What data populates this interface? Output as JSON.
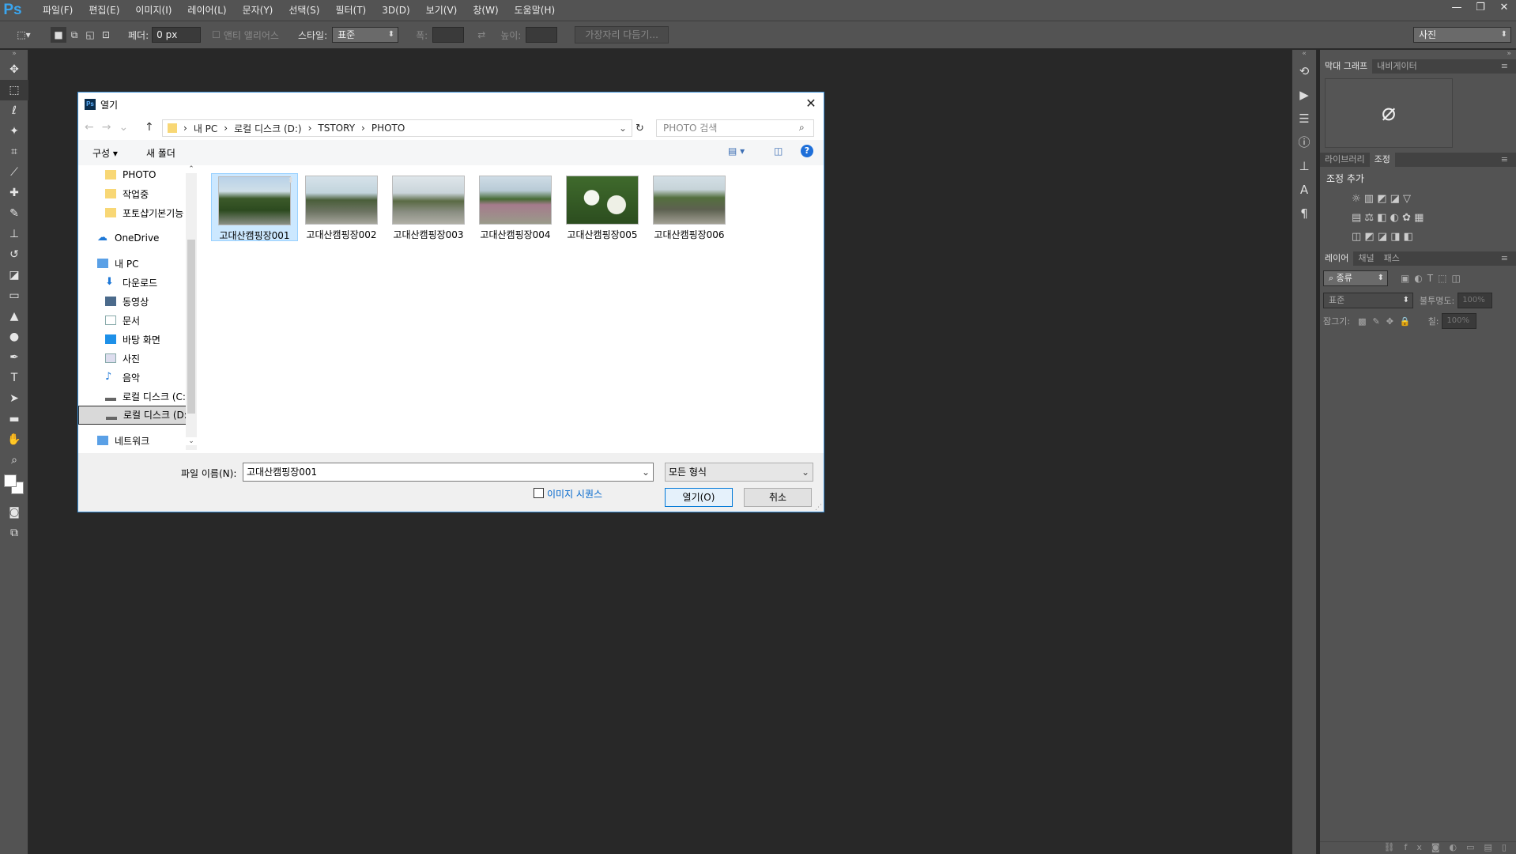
{
  "app": {
    "logo": "Ps"
  },
  "menu": [
    "파일(F)",
    "편집(E)",
    "이미지(I)",
    "레이어(L)",
    "문자(Y)",
    "선택(S)",
    "필터(T)",
    "3D(D)",
    "보기(V)",
    "창(W)",
    "도움말(H)"
  ],
  "window_controls": [
    "—",
    "❐",
    "✕"
  ],
  "options": {
    "feather_label": "페더:",
    "feather_value": "0 px",
    "antialias_label": "앤티 앨리어스",
    "style_label": "스타일:",
    "style_value": "표준",
    "width_label": "폭:",
    "height_label": "높이:",
    "refine_button": "가장자리 다듬기...",
    "workspace": "사진"
  },
  "right_panels": {
    "top_tabs": [
      "막대 그래프",
      "내비게이터"
    ],
    "mid_tabs": [
      "라이브러리",
      "조정"
    ],
    "adjust_title": "조정 추가",
    "layer_tabs": [
      "레이어",
      "채널",
      "패스"
    ],
    "kind_label": "⌕ 종류",
    "blend_mode": "표준",
    "opacity_label": "불투명도:",
    "opacity_value": "100%",
    "lock_label": "잠그기:",
    "fill_label": "칠:",
    "fill_value": "100%"
  },
  "dialog": {
    "title": "열기",
    "breadcrumb": [
      "내 PC",
      "로컬 디스크 (D:)",
      "TSTORY",
      "PHOTO"
    ],
    "search_placeholder": "PHOTO 검색",
    "organize": "구성 ▾",
    "new_folder": "새 폴더",
    "nav_items": [
      {
        "label": "PHOTO",
        "icon": "folder-icon"
      },
      {
        "label": "작업중",
        "icon": "folder-icon"
      },
      {
        "label": "포토샵기본기능",
        "icon": "folder-icon"
      },
      {
        "label": "OneDrive",
        "icon": "cloud-icon"
      },
      {
        "label": "내 PC",
        "icon": "computer-icon"
      },
      {
        "label": "다운로드",
        "icon": "download-icon"
      },
      {
        "label": "동영상",
        "icon": "video-icon"
      },
      {
        "label": "문서",
        "icon": "document-icon"
      },
      {
        "label": "바탕 화면",
        "icon": "desktop-icon"
      },
      {
        "label": "사진",
        "icon": "pictures-icon"
      },
      {
        "label": "음악",
        "icon": "music-icon"
      },
      {
        "label": "로컬 디스크 (C:",
        "icon": "drive-icon"
      },
      {
        "label": "로컬 디스크 (D:",
        "icon": "drive-icon"
      },
      {
        "label": "네트워크",
        "icon": "network-icon"
      }
    ],
    "files": [
      "고대산캠핑장001",
      "고대산캠핑장002",
      "고대산캠핑장003",
      "고대산캠핑장004",
      "고대산캠핑장005",
      "고대산캠핑장006"
    ],
    "filename_label": "파일 이름(N):",
    "filename_value": "고대산캠핑장001",
    "filetype": "모든 형식",
    "sequence_label": "이미지 시퀀스",
    "open_button": "열기(O)",
    "cancel_button": "취소"
  },
  "colors": {
    "ps_blue": "#3aa6f0",
    "panel": "#535353",
    "canvas": "#282828",
    "dialog_border": "#3b8fd6",
    "link": "#0066cc"
  }
}
